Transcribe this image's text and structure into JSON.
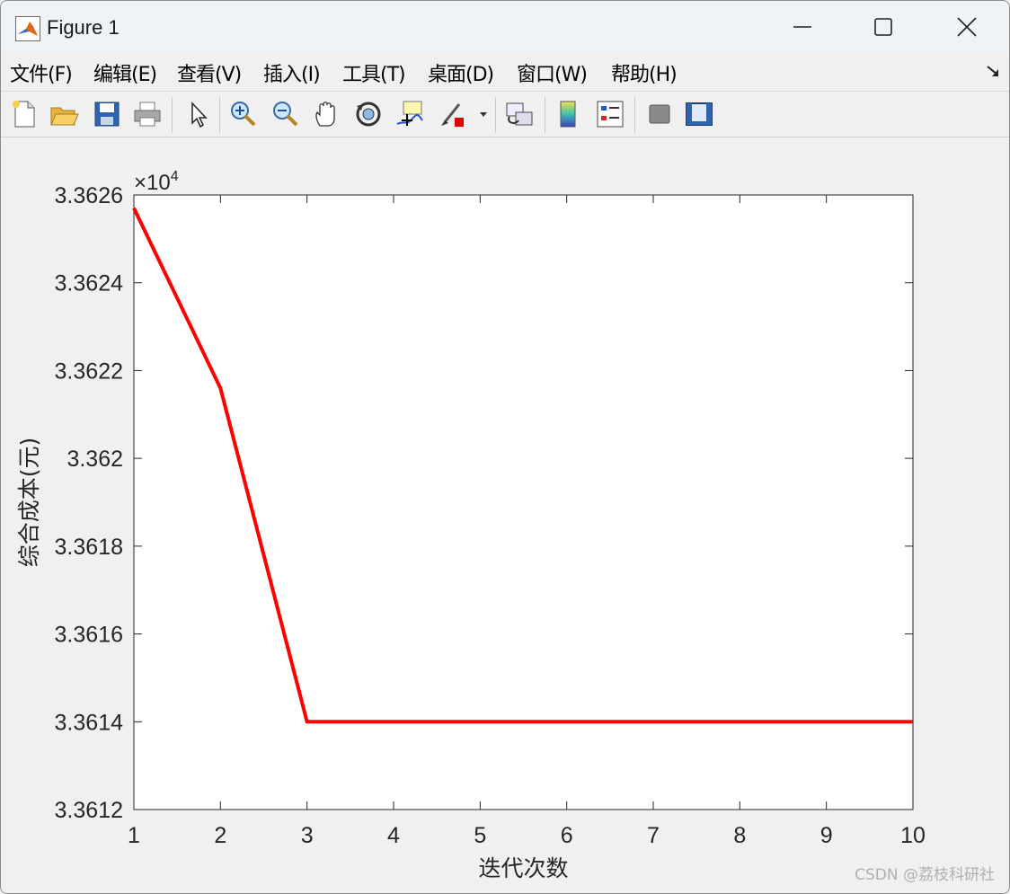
{
  "window": {
    "title": "Figure 1",
    "controls": [
      "minimize",
      "maximize",
      "close"
    ]
  },
  "menu": {
    "items": [
      "文件(F)",
      "编辑(E)",
      "查看(V)",
      "插入(I)",
      "工具(T)",
      "桌面(D)",
      "窗口(W)",
      "帮助(H)"
    ]
  },
  "toolbar": {
    "icons": [
      "new-figure-icon",
      "open-file-icon",
      "save-icon",
      "print-icon",
      "select-arrow-icon",
      "zoom-in-icon",
      "zoom-out-icon",
      "pan-hand-icon",
      "rotate-3d-icon",
      "data-cursor-icon",
      "brush-icon",
      "brush-dropdown-icon",
      "link-plot-icon",
      "colorbar-icon",
      "legend-icon",
      "hide-plot-tools-icon",
      "show-plot-tools-icon"
    ]
  },
  "colors": {
    "line": "#ff0000",
    "axes_bg": "#ffffff",
    "figure_bg": "#f0f0f0"
  },
  "chart_data": {
    "type": "line",
    "title": "",
    "xlabel": "迭代次数",
    "ylabel": "综合成本(元)",
    "y_exponent_label": "×10",
    "y_exponent_power": "4",
    "xlim": [
      1,
      10
    ],
    "ylim": [
      3.3612,
      3.3626
    ],
    "xticks": [
      "1",
      "2",
      "3",
      "4",
      "5",
      "6",
      "7",
      "8",
      "9",
      "10"
    ],
    "yticks": [
      "3.3612",
      "3.3614",
      "3.3616",
      "3.3618",
      "3.362",
      "3.3622",
      "3.3624",
      "3.3626"
    ],
    "x": [
      1,
      2,
      3,
      4,
      5,
      6,
      7,
      8,
      9,
      10
    ],
    "series": [
      {
        "values": [
          3.36257,
          3.36216,
          3.3614,
          3.3614,
          3.3614,
          3.3614,
          3.3614,
          3.3614,
          3.3614,
          3.3614
        ],
        "color": "#ff0000"
      }
    ],
    "grid": false,
    "legend": "none"
  },
  "watermark": "CSDN @荔枝科研社"
}
